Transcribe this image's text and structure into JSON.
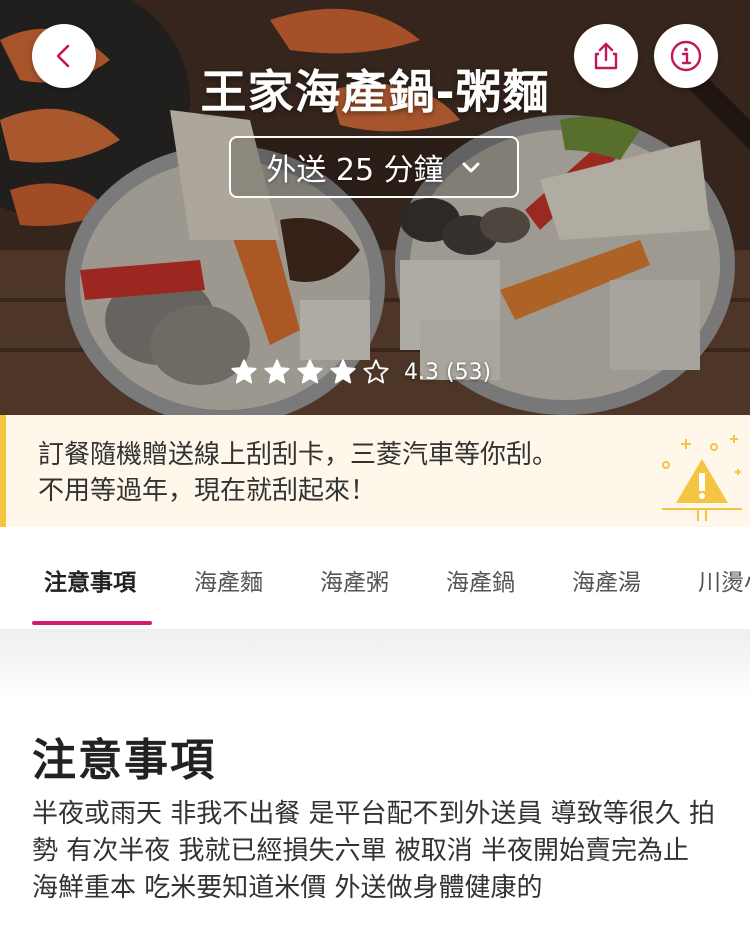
{
  "header": {
    "store_name": "王家海產鍋-粥麵",
    "delivery_label": "外送 25 分鐘",
    "rating_value": 4.3,
    "rating_text": "4.3 (53)",
    "stars_filled": 4,
    "stars_total": 5,
    "icons": {
      "back": "chevron-left-icon",
      "share": "share-icon",
      "info": "info-icon",
      "dropdown": "chevron-down-icon"
    }
  },
  "promo": {
    "text": "訂餐隨機贈送線上刮刮卡，三菱汽車等你刮。不用等過年，現在就刮起來！",
    "icon": "warning-triangle-icon"
  },
  "tabs": [
    {
      "label": "注意事項",
      "active": true
    },
    {
      "label": "海產麵",
      "active": false
    },
    {
      "label": "海產粥",
      "active": false
    },
    {
      "label": "海產鍋",
      "active": false
    },
    {
      "label": "海產湯",
      "active": false
    },
    {
      "label": "川燙小",
      "active": false
    }
  ],
  "section": {
    "title": "注意事項",
    "body": "半夜或雨天 非我不出餐 是平台配不到外送員 導致等很久 拍勢 有次半夜 我就已經損失六單 被取消 半夜開始賣完為止 海鮮重本 吃米要知道米價 外送做身體健康的"
  },
  "colors": {
    "accent": "#d6186e",
    "promo_bg": "#fff8ea",
    "promo_icon": "#f5c542"
  }
}
